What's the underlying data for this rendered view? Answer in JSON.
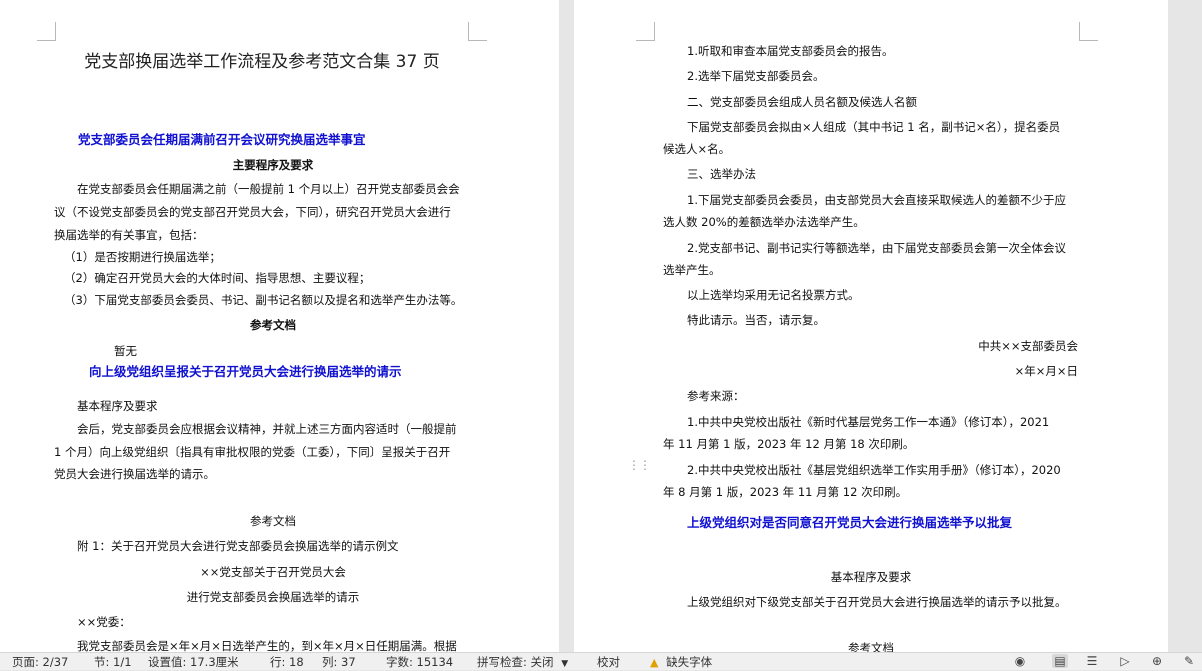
{
  "left_page": {
    "title": "党支部换届选举工作流程及参考范文合集 37 页",
    "section1_heading": "党支部委员会任期届满前召开会议研究换届选举事宜",
    "section1_sub": "主要程序及要求",
    "p1_l1": "在党支部委员会任期届满之前（一般提前 1 个月以上）召开党支部委员会会",
    "p1_l2": "议（不设党支部委员会的党支部召开党员大会，下同），研究召开党员大会进行",
    "p1_l3": "换届选举的有关事宜，包括：",
    "item1": "（1）是否按期进行换届选举；",
    "item2": "（2）确定召开党员大会的大体时间、指导思想、主要议程；",
    "item3": "（3）下届党支部委员会委员、书记、副书记名额以及提名和选举产生办法等。",
    "ref_heading1": "参考文档",
    "none_text": "暂无",
    "section2_heading": "向上级党组织呈报关于召开党员大会进行换届选举的请示",
    "section2_sub": "基本程序及要求",
    "p2_l1": "会后，党支部委员会应根据会议精神，并就上述三方面内容适时（一般提前",
    "p2_l2": "1 个月）向上级党组织〔指具有审批权限的党委（工委），下同〕呈报关于召开",
    "p2_l3": "党员大会进行换届选举的请示。",
    "ref_heading2": "参考文档",
    "appendix": "附 1：关于召开党员大会进行党支部委员会换届选举的请示例文",
    "sample_title1": "××党支部关于召开党员大会",
    "sample_title2": "进行党支部委员会换届选举的请示",
    "addressee": "××党委：",
    "p3_l1": "我党支部委员会是×年×月×日选举产生的，到×年×月×日任期届满。根据"
  },
  "right_page": {
    "r1": "1.听取和审查本届党支部委员会的报告。",
    "r2": "2.选举下届党支部委员会。",
    "r3": "二、党支部委员会组成人员名额及候选人名额",
    "r4_l1": "下届党支部委员会拟由×人组成（其中书记 1 名，副书记×名），提名委员",
    "r4_l2": "候选人×名。",
    "r5": "三、选举办法",
    "r6_l1": "1.下届党支部委员会委员，由支部党员大会直接采取候选人的差额不少于应",
    "r6_l2": "选人数 20%的差额选举办法选举产生。",
    "r7_l1": "2.党支部书记、副书记实行等额选举，由下届党支部委员会第一次全体会议",
    "r7_l2": "选举产生。",
    "r8": "以上选举均采用无记名投票方式。",
    "r9": "特此请示。当否，请示复。",
    "sign_org": "中共××支部委员会",
    "sign_date": "×年×月×日",
    "ref_source": "参考来源：",
    "ref1_l1": "1.中共中央党校出版社《新时代基层党务工作一本通》（修订本），2021",
    "ref1_l2": "年 11 月第 1 版，2023 年 12 月第 18 次印刷。",
    "ref2_l1": "2.中共中央党校出版社《基层党组织选举工作实用手册》（修订本），2020",
    "ref2_l2": "年 8 月第 1 版，2023 年 11 月第 12 次印刷。",
    "section3_heading": "上级党组织对是否同意召开党员大会进行换届选举予以批复",
    "section3_sub": "基本程序及要求",
    "r10": "上级党组织对下级党支部关于召开党员大会进行换届选举的请示予以批复。",
    "ref_heading3": "参考文档"
  },
  "status_bar": {
    "page": "页面: 2/37",
    "section": "节: 1/1",
    "setting": "设置值: 17.3厘米",
    "row": "行: 18",
    "col": "列: 37",
    "word_count": "字数: 15134",
    "spell_check": "拼写检查: 关闭",
    "proofread": "校对",
    "missing_font": "缺失字体"
  },
  "icons": [
    "warning-icon",
    "eye-icon",
    "page-view-icon",
    "outline-view-icon",
    "web-view-icon",
    "play-icon",
    "globe-icon",
    "pen-icon"
  ]
}
